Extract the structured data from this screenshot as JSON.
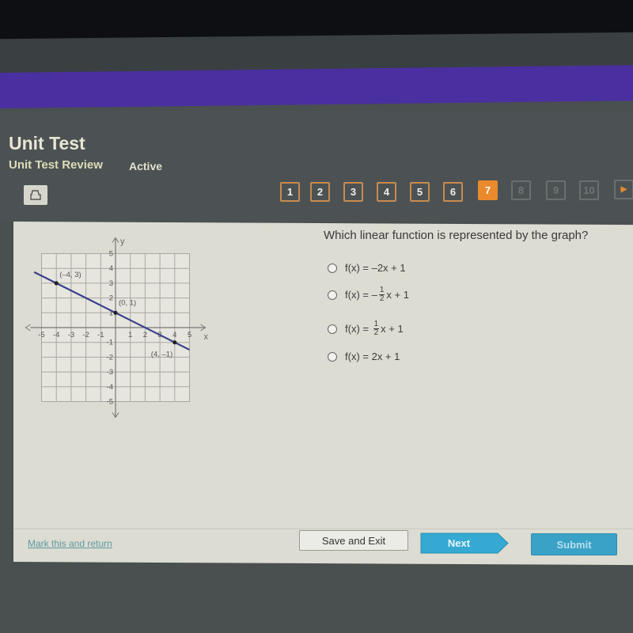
{
  "header": {
    "title": "Unit Test",
    "subtitle": "Unit Test Review",
    "status": "Active"
  },
  "colors": {
    "accent_purple": "#4a2fa0",
    "current_question": "#ea8a2c",
    "question_border": "#c98a4e",
    "next_button": "#35a9d2",
    "submit_button": "#3aa2c6",
    "graph_line": "#3a3e8c"
  },
  "toolbar": {
    "print_icon": "print-icon"
  },
  "question_nav": {
    "items": [
      {
        "label": "1",
        "state": "answered"
      },
      {
        "label": "2",
        "state": "answered"
      },
      {
        "label": "3",
        "state": "answered"
      },
      {
        "label": "4",
        "state": "answered"
      },
      {
        "label": "5",
        "state": "answered"
      },
      {
        "label": "6",
        "state": "answered"
      },
      {
        "label": "7",
        "state": "current"
      },
      {
        "label": "8",
        "state": "locked"
      },
      {
        "label": "9",
        "state": "locked"
      },
      {
        "label": "10",
        "state": "locked"
      }
    ],
    "next_arrow": "▶"
  },
  "question": {
    "text": "Which linear function is represented by the graph?",
    "options": [
      {
        "prefix": "f(x) = ",
        "body": "–2x + 1"
      },
      {
        "prefix": "f(x) = –",
        "frac_num": "1",
        "frac_den": "2",
        "body": "x + 1"
      },
      {
        "prefix": "f(x) = ",
        "frac_num": "1",
        "frac_den": "2",
        "body": "x + 1"
      },
      {
        "prefix": "f(x) = ",
        "body": "2x + 1"
      }
    ]
  },
  "graph": {
    "x_axis_label": "x",
    "y_axis_label": "y",
    "x_ticks": [
      "-5",
      "-4",
      "-3",
      "-2",
      "-1",
      "1",
      "2",
      "3",
      "4",
      "5"
    ],
    "y_ticks": [
      "5",
      "4",
      "3",
      "2",
      "1",
      "-1",
      "-2",
      "-3",
      "-4",
      "-5"
    ],
    "range": {
      "x": [
        -5,
        5
      ],
      "y": [
        -5,
        5
      ]
    },
    "line": {
      "slope": -0.5,
      "intercept": 1
    },
    "points": [
      {
        "x": -4,
        "y": 3,
        "label": "(–4, 3)"
      },
      {
        "x": 0,
        "y": 1,
        "label": "(0, 1)"
      },
      {
        "x": 4,
        "y": -1,
        "label": "(4, –1)"
      }
    ]
  },
  "footer": {
    "mark_link": "Mark this and return",
    "save_exit": "Save and Exit",
    "next": "Next",
    "submit": "Submit"
  }
}
